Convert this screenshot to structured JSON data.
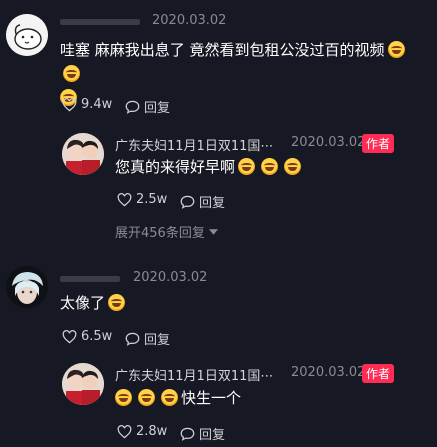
{
  "comments": [
    {
      "date": "2020.03.02",
      "text": "哇塞 麻麻我出息了 竟然看到包租公没过百的视频",
      "likes": "9.4w",
      "reply_label": "回复",
      "replies": [
        {
          "author": "广东夫妇11月1日双11国⋯",
          "date": "2020.03.02",
          "badge": "作者",
          "text": "您真的来得好早啊",
          "likes": "2.5w",
          "reply_label": "回复"
        }
      ],
      "expand_label": "展开456条回复"
    },
    {
      "date": "2020.03.02",
      "text": "太像了",
      "likes": "6.5w",
      "reply_label": "回复",
      "replies": [
        {
          "author": "广东夫妇11月1日双11国⋯",
          "date": "2020.03.02",
          "badge": "作者",
          "text": "快生一个",
          "likes": "2.8w",
          "reply_label": "回复"
        }
      ]
    }
  ],
  "icons": {
    "like": "heart-outline-icon",
    "reply": "speech-bubble-icon",
    "emoji": "laughing-crying-emoji",
    "expand": "chevron-down-icon"
  },
  "colors": {
    "background": "#161823",
    "badge": "#fe2c55"
  }
}
